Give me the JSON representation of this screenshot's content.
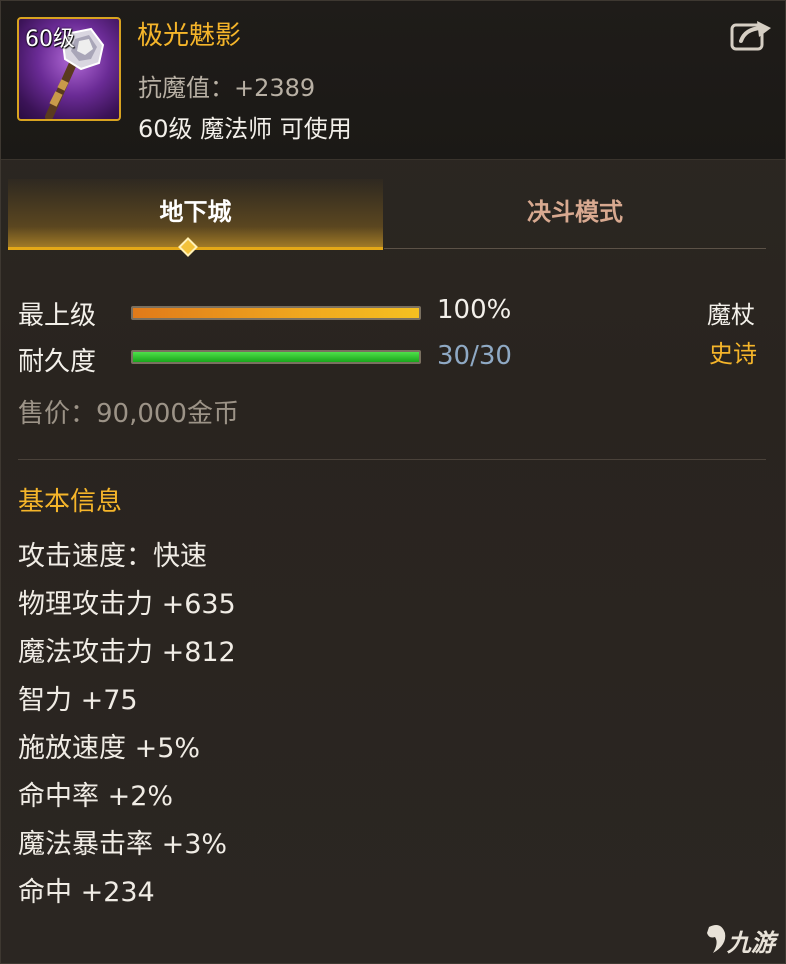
{
  "item": {
    "level_badge": "60级",
    "name": "极光魅影",
    "anti_magic": "抗魔值：+2389",
    "requirement": "60级 魔法师 可使用"
  },
  "tabs": [
    {
      "label": "地下城",
      "active": true
    },
    {
      "label": "决斗模式",
      "active": false
    }
  ],
  "stats": {
    "grade_label": "最上级",
    "grade_value": "100%",
    "grade_fraction": 1.0,
    "durability_label": "耐久度",
    "durability_value": "30/30",
    "durability_fraction": 1.0
  },
  "item_type": "魔杖",
  "rarity": "史诗",
  "price": "售价：90,000金币",
  "basic_info": {
    "title": "基本信息",
    "lines": [
      "攻击速度：快速",
      "物理攻击力 +635",
      "魔法攻击力 +812",
      "智力 +75",
      "施放速度 +5%",
      "命中率 +2%",
      "魔法暴击率 +3%",
      "命中 +234"
    ]
  },
  "watermark": "九游",
  "colors": {
    "accent_gold": "#f5b52a",
    "epic_orange": "#f5b52a",
    "grade_bar": "#f0a81e",
    "durability_bar": "#2cc62a",
    "durability_text": "#8fa9c4"
  },
  "icons": {
    "item": "magic-staff-icon",
    "share": "share-icon"
  }
}
